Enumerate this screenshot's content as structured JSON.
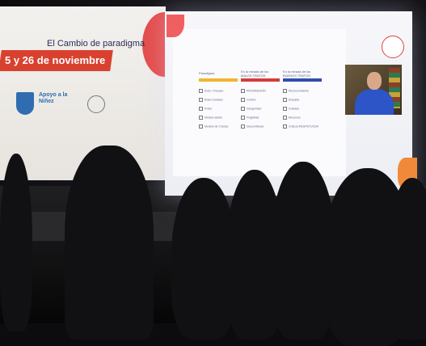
{
  "banner": {
    "date_text": "5 y 26 de noviembre",
    "org_text": "Apoyo a la Niñez"
  },
  "slide": {
    "title": "El Cambio de paradigma",
    "columns": [
      {
        "header": "Paradigma",
        "color": "#f1b533"
      },
      {
        "header": "En la mirada de los MALES TRATOS",
        "color": "#d63b3b"
      },
      {
        "header": "En la mirada de los BUENOS TRATOS",
        "color": "#2f4fa8"
      }
    ],
    "rows": [
      [
        "Éxito / Fracaso",
        "PROGRESIÓN",
        "Reconocimiento"
      ],
      [
        "Roles sociales",
        "Control",
        "Empatía"
      ],
      [
        "Poder",
        "Inseguridad",
        "Cuidado"
      ],
      [
        "Modelo adulto",
        "Fragilidad",
        "Recursos"
      ],
      [
        "Modelo de Crianza",
        "Desconfianza",
        "Crianza RESPETUOSA"
      ]
    ]
  },
  "colors": {
    "banner_red": "#d9412f",
    "slide_title": "#2b2d56",
    "screen_bg": "#f7f7fa"
  }
}
